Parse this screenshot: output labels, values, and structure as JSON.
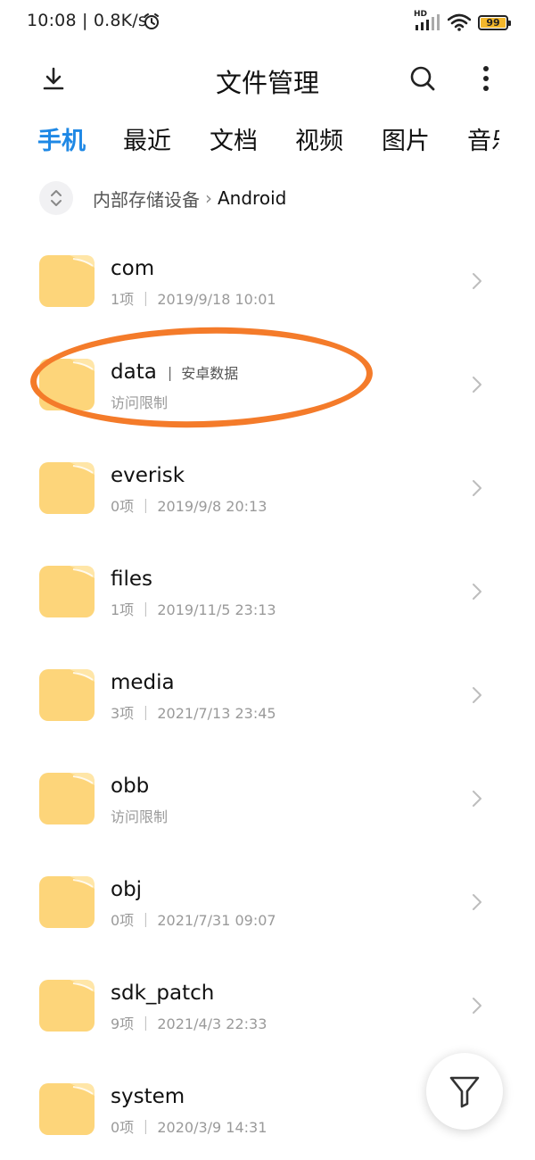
{
  "status_bar": {
    "time_speed": "10:08 | 0.8K/s",
    "network_label": "HD",
    "battery": "99"
  },
  "header": {
    "title": "文件管理",
    "download_icon": "download-icon",
    "search_icon": "search-icon",
    "more_icon": "more-vertical-icon"
  },
  "tabs": [
    "手机",
    "最近",
    "文档",
    "视频",
    "图片",
    "音乐"
  ],
  "active_tab": "手机",
  "breadcrumb": {
    "root": "内部存储设备",
    "current": "Android"
  },
  "folders": [
    {
      "name": "com",
      "meta": "1项 ｜ 2019/9/18 10:01",
      "tag": ""
    },
    {
      "name": "data",
      "meta": "访问限制",
      "tag": "安卓数据"
    },
    {
      "name": "everisk",
      "meta": "0项 ｜ 2019/9/8 20:13",
      "tag": ""
    },
    {
      "name": "files",
      "meta": "1项 ｜ 2019/11/5 23:13",
      "tag": ""
    },
    {
      "name": "media",
      "meta": "3项 ｜ 2021/7/13 23:45",
      "tag": ""
    },
    {
      "name": "obb",
      "meta": "访问限制",
      "tag": ""
    },
    {
      "name": "obj",
      "meta": "0项 ｜ 2021/7/31 09:07",
      "tag": ""
    },
    {
      "name": "sdk_patch",
      "meta": "9项 ｜ 2021/4/3 22:33",
      "tag": ""
    },
    {
      "name": "system",
      "meta": "0项 ｜ 2020/3/9 14:31",
      "tag": ""
    }
  ],
  "colors": {
    "accent": "#1e88e5",
    "folder": "#fdd57a",
    "highlight": "#f47b2a"
  },
  "fab_icon": "filter-icon"
}
